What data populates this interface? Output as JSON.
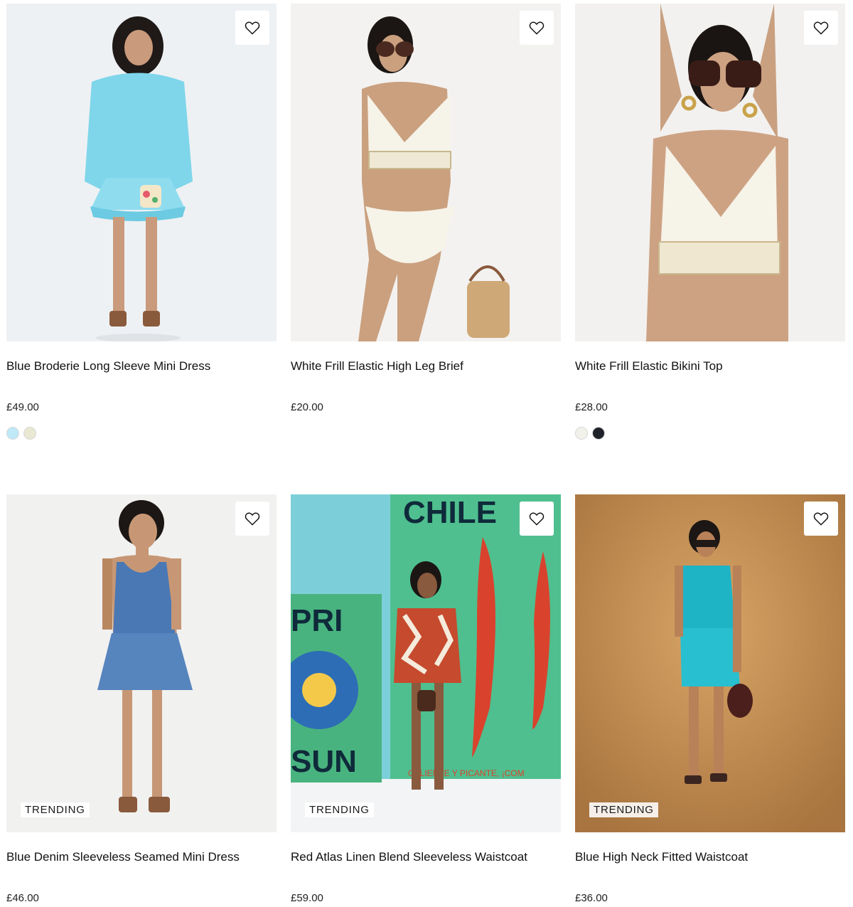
{
  "products": [
    {
      "title": "Blue Broderie Long Sleeve Mini Dress",
      "price": "£49.00",
      "swatches": [
        "#bfe9f6",
        "#e9e8d2"
      ]
    },
    {
      "title": "White Frill Elastic High Leg Brief",
      "price": "£20.00",
      "swatches": []
    },
    {
      "title": "White Frill Elastic Bikini Top",
      "price": "£28.00",
      "swatches": [
        "#f2f1ea",
        "#1f2329"
      ]
    },
    {
      "title": "Blue Denim Sleeveless Seamed Mini Dress",
      "price": "£46.00",
      "badge": "TRENDING",
      "swatches": []
    },
    {
      "title": "Red Atlas Linen Blend Sleeveless Waistcoat",
      "price": "£59.00",
      "badge": "TRENDING",
      "swatches": []
    },
    {
      "title": "Blue High Neck Fitted Waistcoat",
      "price": "£36.00",
      "badge": "TRENDING",
      "swatches": []
    }
  ],
  "artwork": {
    "chiles_sign": "CHILE",
    "pri_text": "PRI",
    "sun_text": "SUN",
    "caliente_text": "CALIENTE Y PICANTE, ¡COM"
  },
  "icons": {
    "wishlist": "heart-outline-icon"
  }
}
